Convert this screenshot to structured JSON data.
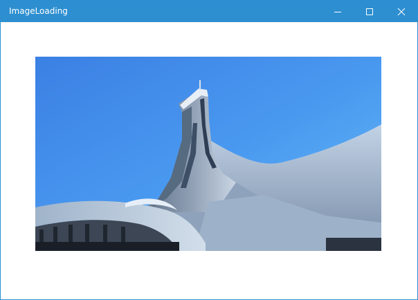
{
  "window": {
    "title": "ImageLoading",
    "controls": [
      {
        "name": "minimize",
        "icon": "minimize-icon"
      },
      {
        "name": "maximize",
        "icon": "maximize-icon"
      },
      {
        "name": "close",
        "icon": "close-icon"
      }
    ]
  },
  "colors": {
    "titlebar": "#2d8fd0",
    "border": "#2a8fd1",
    "sky_top": "#3f86e6",
    "sky_bottom": "#63b3f4"
  },
  "content": {
    "image_subject": "stadium-tower-photo"
  }
}
